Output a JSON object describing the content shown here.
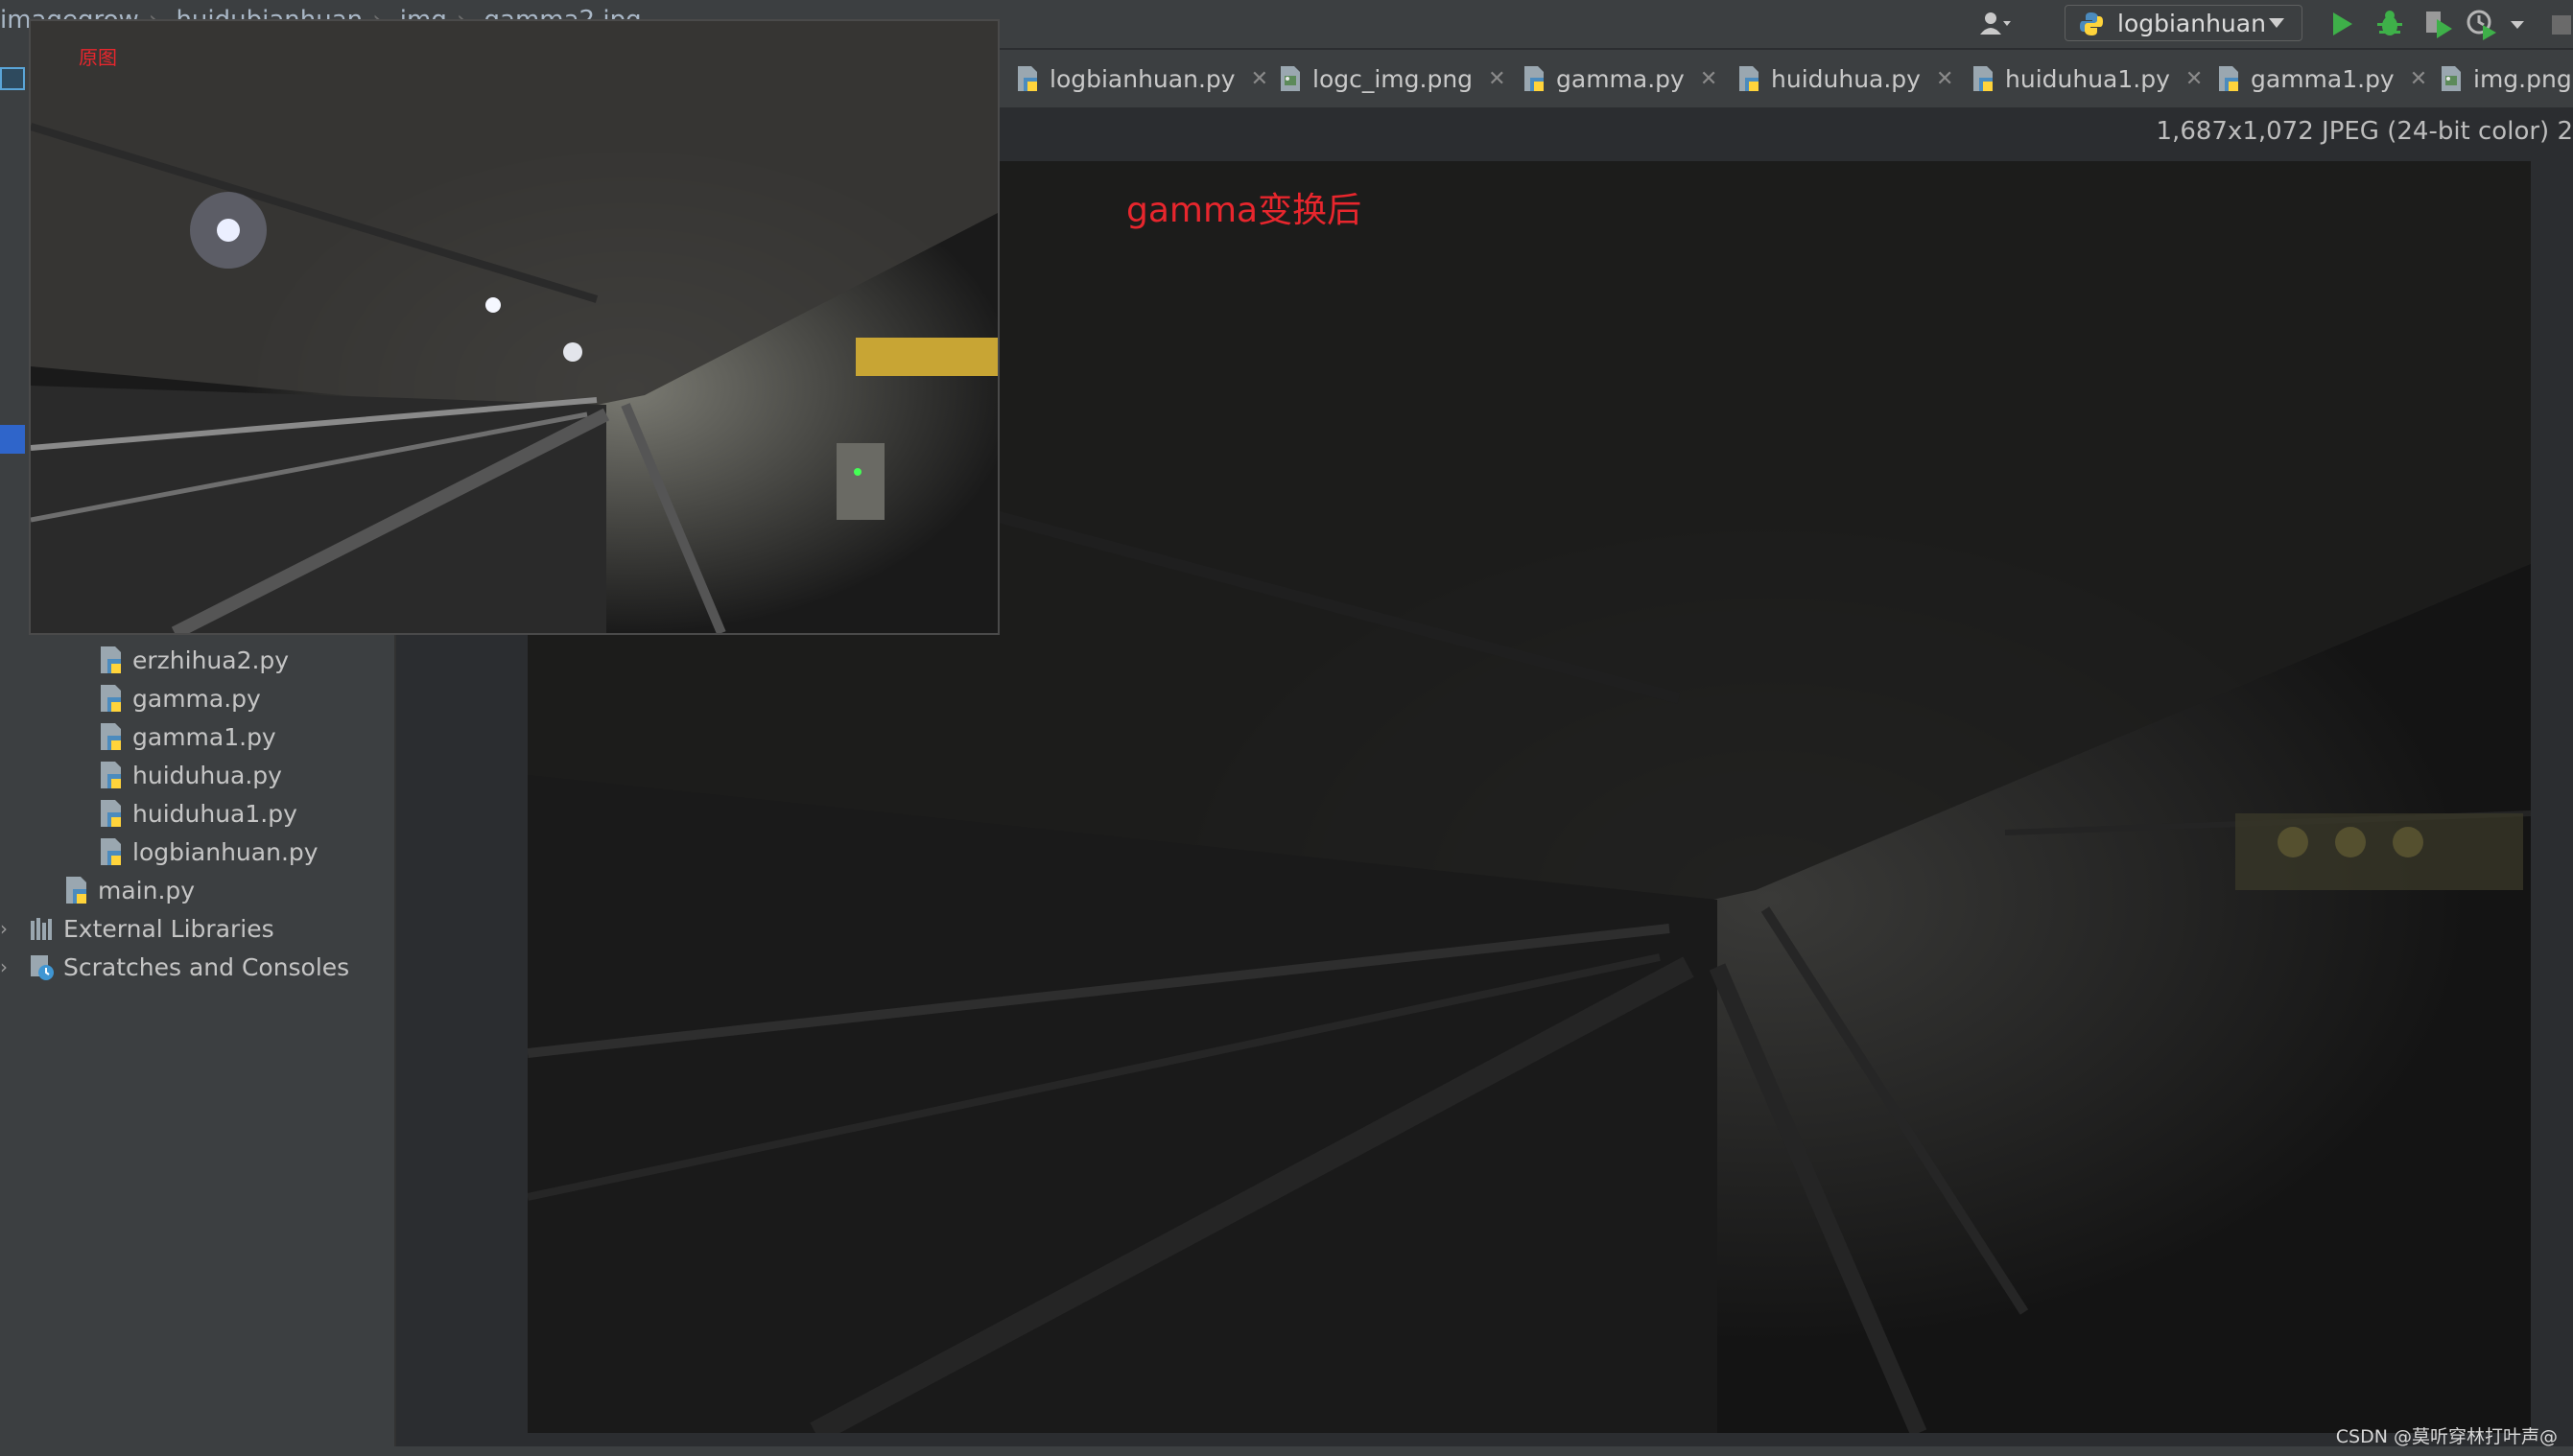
{
  "breadcrumbs": [
    "imagegrow",
    "huidubianhuan",
    "img",
    "gamma2.jpg"
  ],
  "run_config": {
    "label": "logbianhuan"
  },
  "tabs": [
    {
      "label": "logbianhuan.py",
      "icon": "python-file-icon"
    },
    {
      "label": "logc_img.png",
      "icon": "image-file-icon"
    },
    {
      "label": "gamma.py",
      "icon": "python-file-icon"
    },
    {
      "label": "huiduhua.py",
      "icon": "python-file-icon"
    },
    {
      "label": "huiduhua1.py",
      "icon": "python-file-icon"
    },
    {
      "label": "gamma1.py",
      "icon": "python-file-icon"
    },
    {
      "label": "img.png",
      "icon": "image-file-icon"
    }
  ],
  "image_info": "1,687x1,072 JPEG (24-bit color) 2",
  "tree": {
    "files": [
      "erzhihua2.py",
      "gamma.py",
      "gamma1.py",
      "huiduhua.py",
      "huiduhua1.py",
      "logbianhuan.py"
    ],
    "main": "main.py",
    "external": "External Libraries",
    "scratches": "Scratches and Consoles"
  },
  "overlay": {
    "label": "原图"
  },
  "main_image": {
    "label": "gamma变换后"
  },
  "watermark": "CSDN @莫听穿林打叶声@",
  "colors": {
    "accent_red": "#e8262d",
    "run_green": "#3eb049",
    "selection_blue": "#2f65ca"
  }
}
